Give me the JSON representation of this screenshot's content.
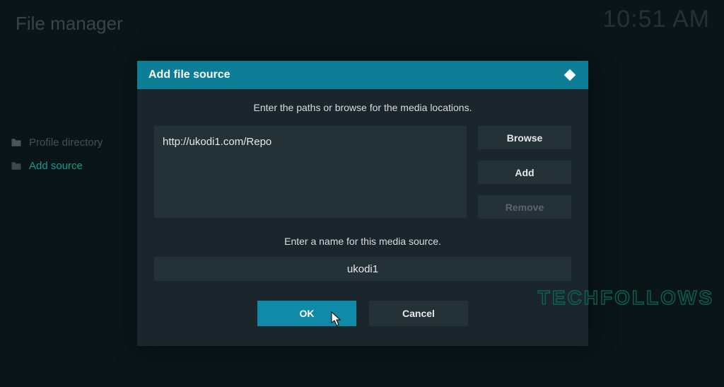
{
  "header": {
    "title": "File manager",
    "clock": "10:51 AM"
  },
  "sidebar": {
    "items": [
      {
        "label": "Profile directory"
      },
      {
        "label": "Add source"
      }
    ]
  },
  "dialog": {
    "title": "Add file source",
    "paths_instruction": "Enter the paths or browse for the media locations.",
    "path_value": "http://ukodi1.com/Repo",
    "browse_label": "Browse",
    "add_label": "Add",
    "remove_label": "Remove",
    "name_instruction": "Enter a name for this media source.",
    "name_value": "ukodi1",
    "ok_label": "OK",
    "cancel_label": "Cancel"
  },
  "watermark": "TECHFOLLOWS"
}
